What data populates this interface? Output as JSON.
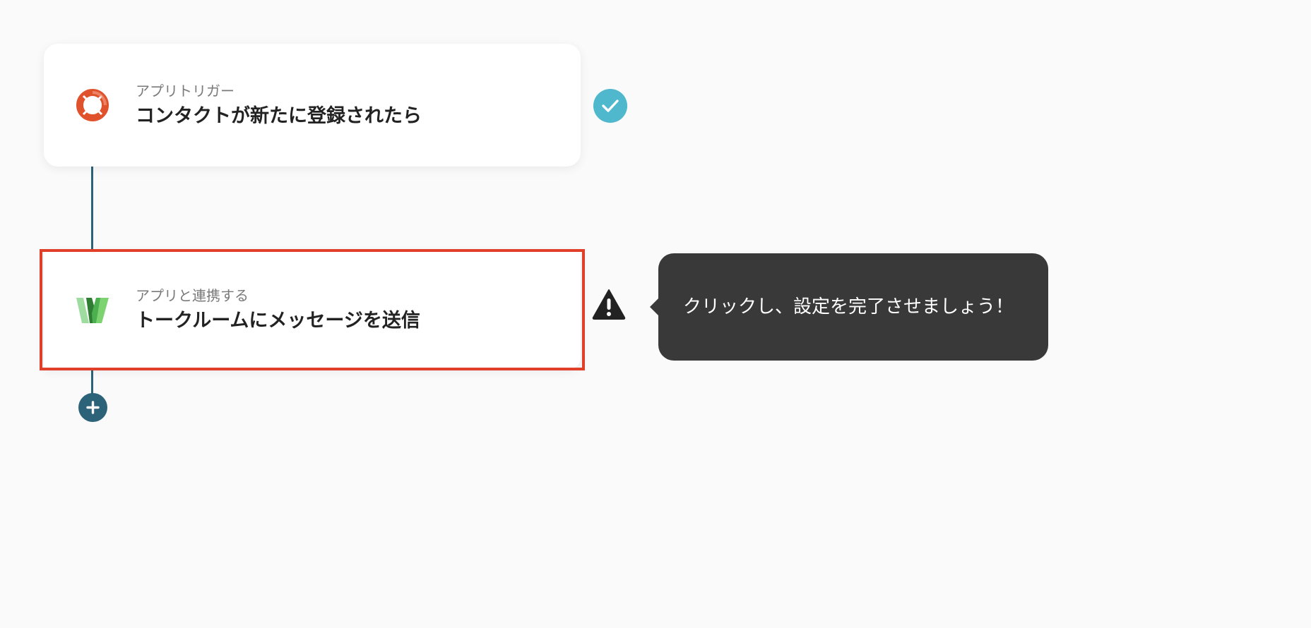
{
  "flow": {
    "steps": [
      {
        "subtitle": "アプリトリガー",
        "title": "コンタクトが新たに登録されたら",
        "icon": "lifebuoy-app-icon",
        "status": "check-icon"
      },
      {
        "subtitle": "アプリと連携する",
        "title": "トークルームにメッセージを送信",
        "icon": "w-app-icon",
        "status": "warning-icon"
      }
    ],
    "tooltip": "クリックし、設定を完了させましょう！",
    "add_step_icon": "plus-icon"
  },
  "colors": {
    "background": "#fafafa",
    "connector": "#2c6378",
    "highlight": "#e0402a",
    "check": "#4fb8cd",
    "tooltip_bg": "#393939",
    "trigger_icon": "#e0522c",
    "action_icon_green": "#4caf50"
  }
}
